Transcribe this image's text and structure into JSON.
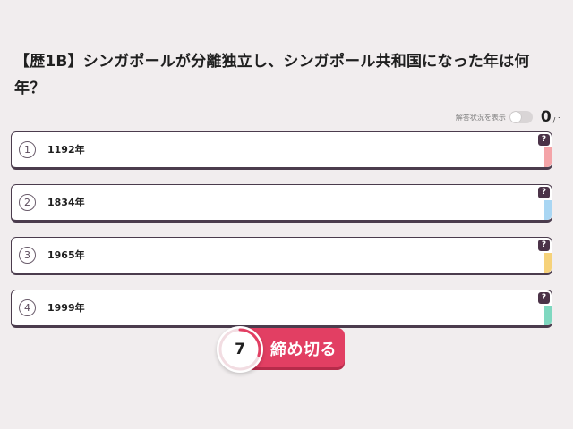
{
  "question": {
    "text": "【歴1B】シンガポールが分離独立し、シンガポール共和国になった年は何年？"
  },
  "answer_status": {
    "label": "解答状況を表示",
    "toggle_on": false,
    "answered_count": "0",
    "total": "/ 1"
  },
  "choices": [
    {
      "number": "1",
      "label": "1192年",
      "badge": "?",
      "color": "#f4a4a8"
    },
    {
      "number": "2",
      "label": "1834年",
      "badge": "?",
      "color": "#a9d6f3"
    },
    {
      "number": "3",
      "label": "1965年",
      "badge": "?",
      "color": "#f6d27a"
    },
    {
      "number": "4",
      "label": "1999年",
      "badge": "?",
      "color": "#7fd8c0"
    }
  ],
  "deadline": {
    "timer_value": "7",
    "button_label": "締め切る",
    "timer_remaining_fraction": 0.3,
    "accent_color": "#e23f63"
  }
}
